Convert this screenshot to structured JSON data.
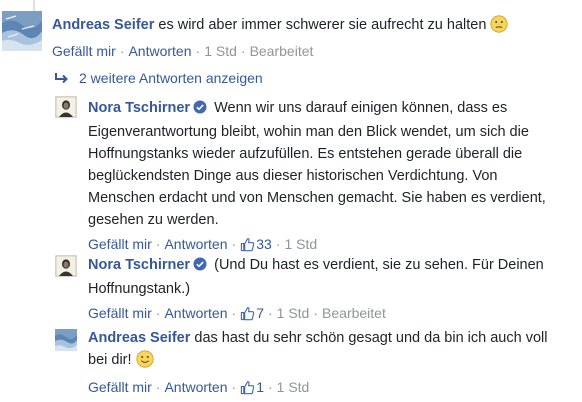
{
  "comments": [
    {
      "author": "Andreas Seifer",
      "text": "es wird aber immer schwerer sie aufrecht zu halten",
      "emoji": "confused-face",
      "like_label": "Gefällt mir",
      "reply_label": "Antworten",
      "time": "1 Std",
      "edited": "Bearbeitet"
    },
    {
      "author": "Nora Tschirner",
      "verified": true,
      "text": "Wenn wir uns darauf einigen können, dass es Eigenverantwortung bleibt, wohin man den Blick wendet, um sich die Hoffnungstanks wieder aufzufüllen. Es entstehen gerade überall die beglückendsten Dinge aus dieser historischen Verdichtung. Von Menschen erdacht und von Menschen gemacht. Sie haben es verdient, gesehen zu werden.",
      "like_label": "Gefällt mir",
      "reply_label": "Antworten",
      "likes": "33",
      "time": "1 Std"
    },
    {
      "author": "Nora Tschirner",
      "verified": true,
      "text": "(Und Du hast es verdient, sie zu sehen. Für Deinen Hoffnungstank.)",
      "like_label": "Gefällt mir",
      "reply_label": "Antworten",
      "likes": "7",
      "time": "1 Std",
      "edited": "Bearbeitet"
    },
    {
      "author": "Andreas Seifer",
      "text": "das hast du sehr schön gesagt und da bin ich auch voll bei dir!",
      "emoji": "smiley-face",
      "like_label": "Gefällt mir",
      "reply_label": "Antworten",
      "likes": "1",
      "time": "1 Std"
    }
  ],
  "more_replies": "2 weitere Antworten anzeigen",
  "colors": {
    "link": "#365899",
    "meta": "#90949c",
    "text": "#1d2129",
    "verified": "#4267b2",
    "emoji": "#f7d45c"
  }
}
